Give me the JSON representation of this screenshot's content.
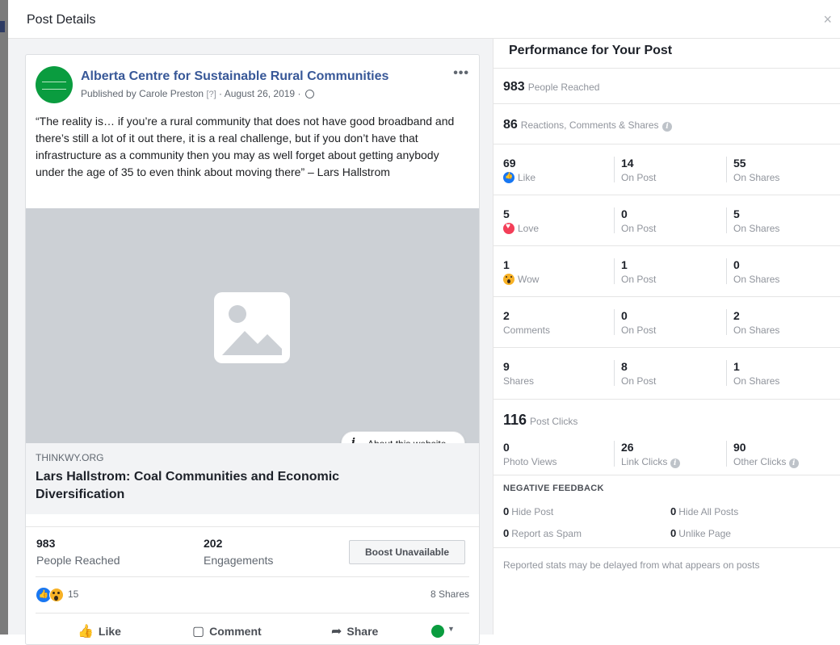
{
  "modal": {
    "title": "Post Details",
    "close": "×"
  },
  "post": {
    "page_name": "Alberta Centre for Sustainable Rural Communities",
    "published_prefix": "Published by",
    "author": "Carole Preston",
    "help_marker": "[?]",
    "date": "· August 26, 2019 ·",
    "more": "•••",
    "text": "“The reality is… if you’re a rural community that does not have good broadband and there’s still a lot of it out there, it is a real challenge, but if you don’t have that infrastructure as a community then you may as well forget about getting anybody under the age of 35 to even think about moving there” – Lars Hallstrom",
    "about_site": "About this website",
    "link_domain": "THINKWY.ORG",
    "link_title": "Lars Hallstrom: Coal Communities and Economic Diversification",
    "people_reached_value": "983",
    "people_reached_label": "People Reached",
    "engagements_value": "202",
    "engagements_label": "Engagements",
    "boost_label": "Boost Unavailable",
    "reaction_count": "15",
    "shares_count": "8 Shares",
    "actions": {
      "like": "Like",
      "comment": "Comment",
      "share": "Share"
    }
  },
  "performance": {
    "title": "Performance for Your Post",
    "reached_value": "983",
    "reached_label": "People Reached",
    "rcs_value": "86",
    "rcs_label": "Reactions, Comments & Shares",
    "rows": [
      {
        "total": "69",
        "label": "Like",
        "icon": "like",
        "on_post": "14",
        "on_post_label": "On Post",
        "on_shares": "55",
        "on_shares_label": "On Shares"
      },
      {
        "total": "5",
        "label": "Love",
        "icon": "love",
        "on_post": "0",
        "on_post_label": "On Post",
        "on_shares": "5",
        "on_shares_label": "On Shares"
      },
      {
        "total": "1",
        "label": "Wow",
        "icon": "wow",
        "on_post": "1",
        "on_post_label": "On Post",
        "on_shares": "0",
        "on_shares_label": "On Shares"
      },
      {
        "total": "2",
        "label": "Comments",
        "icon": "",
        "on_post": "0",
        "on_post_label": "On Post",
        "on_shares": "2",
        "on_shares_label": "On Shares"
      },
      {
        "total": "9",
        "label": "Shares",
        "icon": "",
        "on_post": "8",
        "on_post_label": "On Post",
        "on_shares": "1",
        "on_shares_label": "On Shares"
      }
    ],
    "clicks_value": "116",
    "clicks_label": "Post Clicks",
    "photo_views_value": "0",
    "photo_views_label": "Photo Views",
    "link_clicks_value": "26",
    "link_clicks_label": "Link Clicks",
    "other_clicks_value": "90",
    "other_clicks_label": "Other Clicks",
    "negative": {
      "title": "NEGATIVE FEEDBACK",
      "hide_post_value": "0",
      "hide_post_label": "Hide Post",
      "hide_all_value": "0",
      "hide_all_label": "Hide All Posts",
      "spam_value": "0",
      "spam_label": "Report as Spam",
      "unlike_value": "0",
      "unlike_label": "Unlike Page"
    },
    "footnote": "Reported stats may be delayed from what appears on posts"
  }
}
